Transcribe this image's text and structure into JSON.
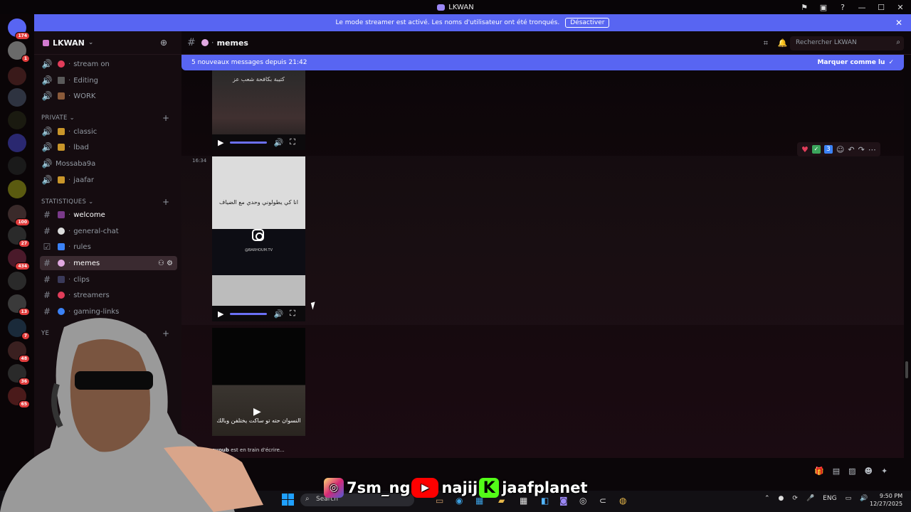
{
  "window": {
    "title": "LKWAN"
  },
  "banner": {
    "text": "Le mode streamer est activé. Les noms d'utilisateur ont été tronqués.",
    "button": "Désactiver"
  },
  "servers": {
    "badges": [
      "174",
      "1",
      "100",
      "27",
      "434",
      "13",
      "7",
      "48",
      "36",
      "65"
    ]
  },
  "guild": {
    "name": "LKWAN"
  },
  "channels": {
    "top": [
      {
        "label": "stream on"
      },
      {
        "label": "Editing"
      },
      {
        "label": "WORK"
      }
    ],
    "private_label": "PRIVATE",
    "private": [
      {
        "label": "classic"
      },
      {
        "label": "lbad"
      },
      {
        "label": "Mossaba9a"
      },
      {
        "label": "jaafar"
      }
    ],
    "stats_label": "STATISTIQUES",
    "stats": [
      {
        "label": "welcome"
      },
      {
        "label": "general-chat"
      },
      {
        "label": "rules"
      },
      {
        "label": "memes"
      },
      {
        "label": "clips"
      },
      {
        "label": "streamers"
      },
      {
        "label": "gaming-links"
      }
    ],
    "partial_category": "YE"
  },
  "header": {
    "channel": "memes",
    "search_placeholder": "Rechercher LKWAN"
  },
  "newbar": {
    "text": "5 nouveaux messages depuis 21:42",
    "mark": "Marquer comme lu"
  },
  "messages": {
    "timestamp": "16:34",
    "video1_caption": "كتيبة بكافحة شعب عز",
    "video2_caption": "انا كي يطولوني وحدي مع الضياف",
    "video2_handle": "@BARHOUM.TV",
    "video3_caption": "النسوان حته تو ساكت يختلفن وبالك",
    "reaction_count": "3"
  },
  "typing": {
    "user": "ayoub",
    "text": " est en train d'écrire..."
  },
  "taskbar": {
    "search": "Search",
    "lang": "ENG",
    "time": "9:50 PM",
    "date": "12/27/2025"
  },
  "overlay": {
    "instagram": "7sm_ng",
    "youtube": "najij",
    "kick": "jaafplanet"
  },
  "colors": {
    "accent": "#5865f2",
    "background": "#0b0609",
    "sidebar": "#150c10"
  }
}
